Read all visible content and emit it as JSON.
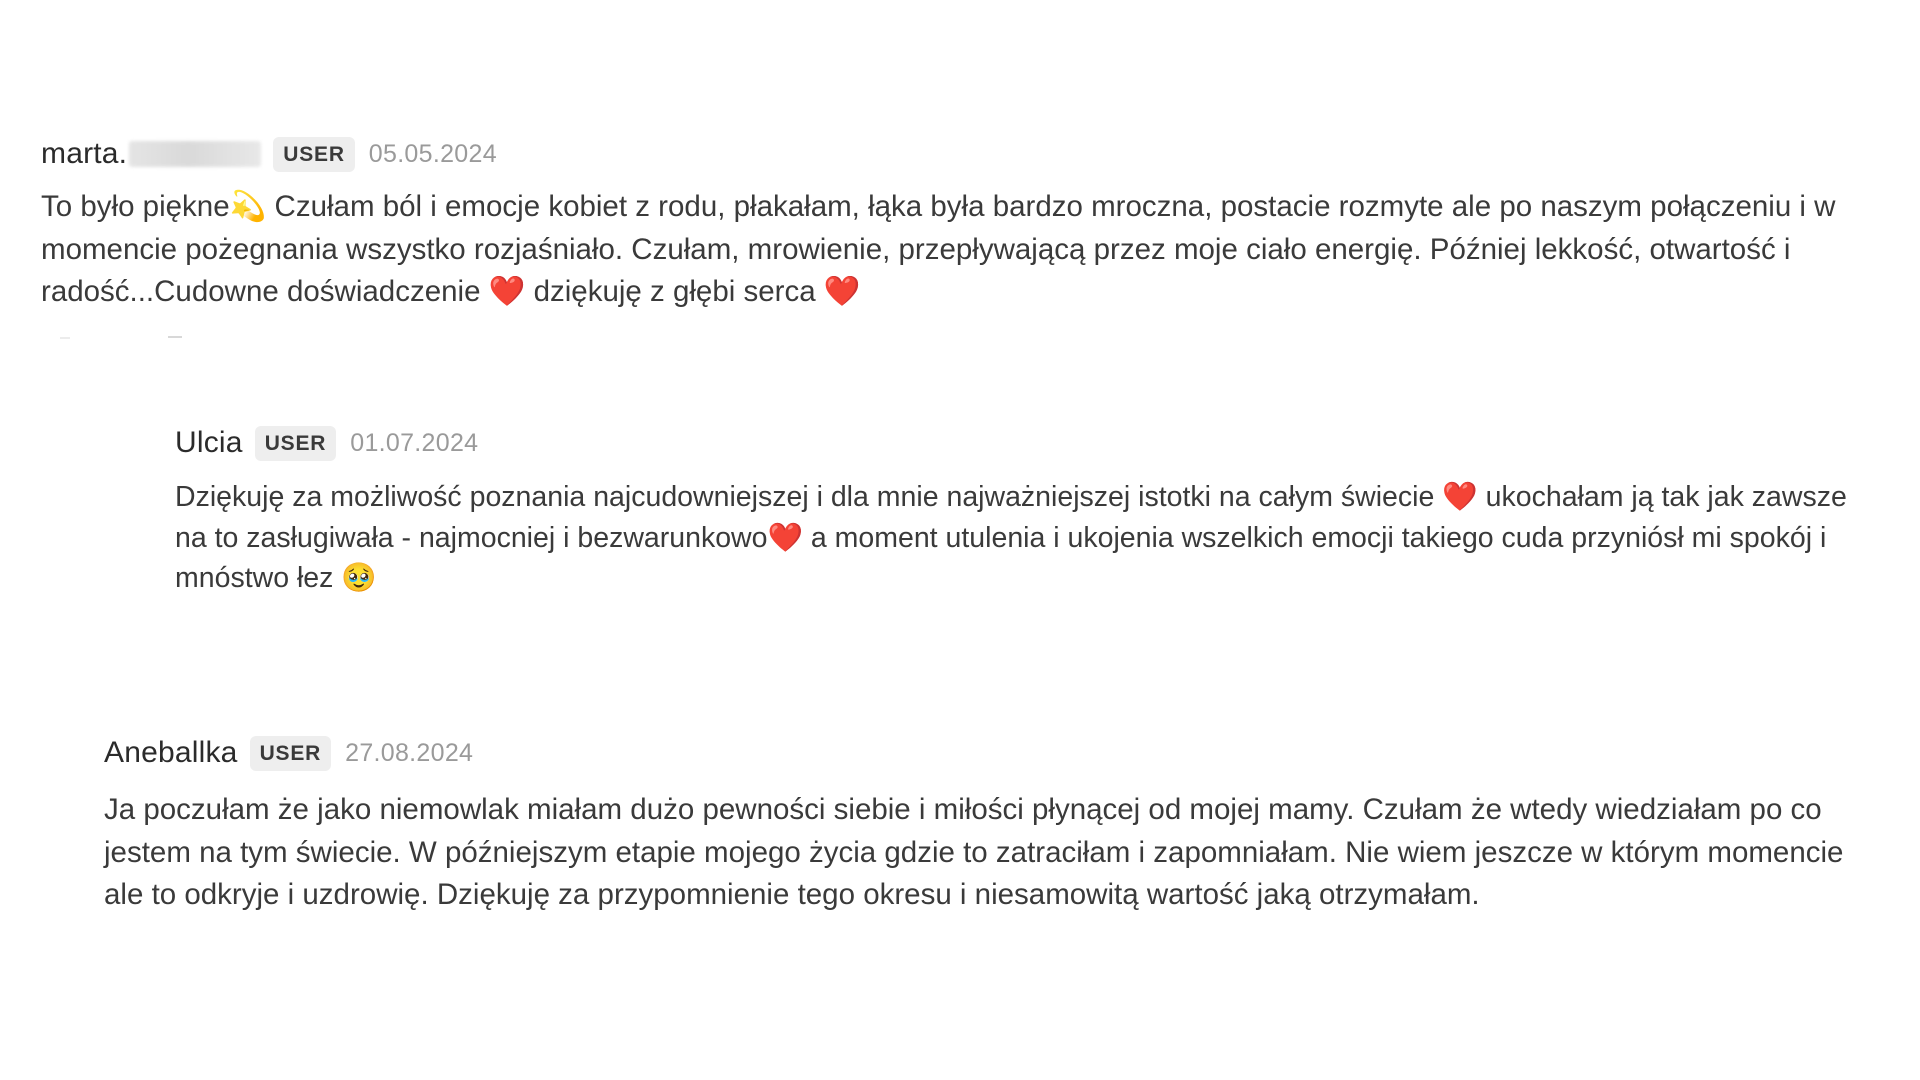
{
  "comments": [
    {
      "author": "marta.",
      "badge": "USER",
      "date": "05.05.2024",
      "text": "To było piękne💫 Czułam ból i emocje kobiet z rodu, płakałam, łąka była bardzo mroczna, postacie rozmyte ale po naszym połączeniu i w momencie pożegnania wszystko rozjaśniało. Czułam, mrowienie, przepływającą przez moje ciało energię. Później lekkość, otwartość i radość...Cudowne doświadczenie ❤️ dziękuję z głębi serca ❤️"
    },
    {
      "author": "Ulcia",
      "badge": "USER",
      "date": "01.07.2024",
      "text": "Dziękuję za możliwość poznania najcudowniejszej i dla mnie najważniejszej istotki na całym świecie ❤️ ukochałam ją tak jak zawsze na to zasługiwała - najmocniej i bezwarunkowo❤️ a moment utulenia i ukojenia wszelkich emocji takiego cuda przyniósł mi spokój i mnóstwo łez 🥹"
    },
    {
      "author": "Aneballka",
      "badge": "USER",
      "date": "27.08.2024",
      "text": "Ja poczułam że jako niemowlak miałam dużo pewności siebie i miłości płynącej od mojej mamy. Czułam że wtedy wiedziałam po co jestem na tym świecie. W późniejszym etapie mojego życia gdzie to zatraciłam i zapomniałam. Nie wiem jeszcze w którym momencie ale to odkryje i uzdrowię. Dziękuję za przypomnienie tego okresu i niesamowitą wartość jaką otrzymałam."
    }
  ]
}
